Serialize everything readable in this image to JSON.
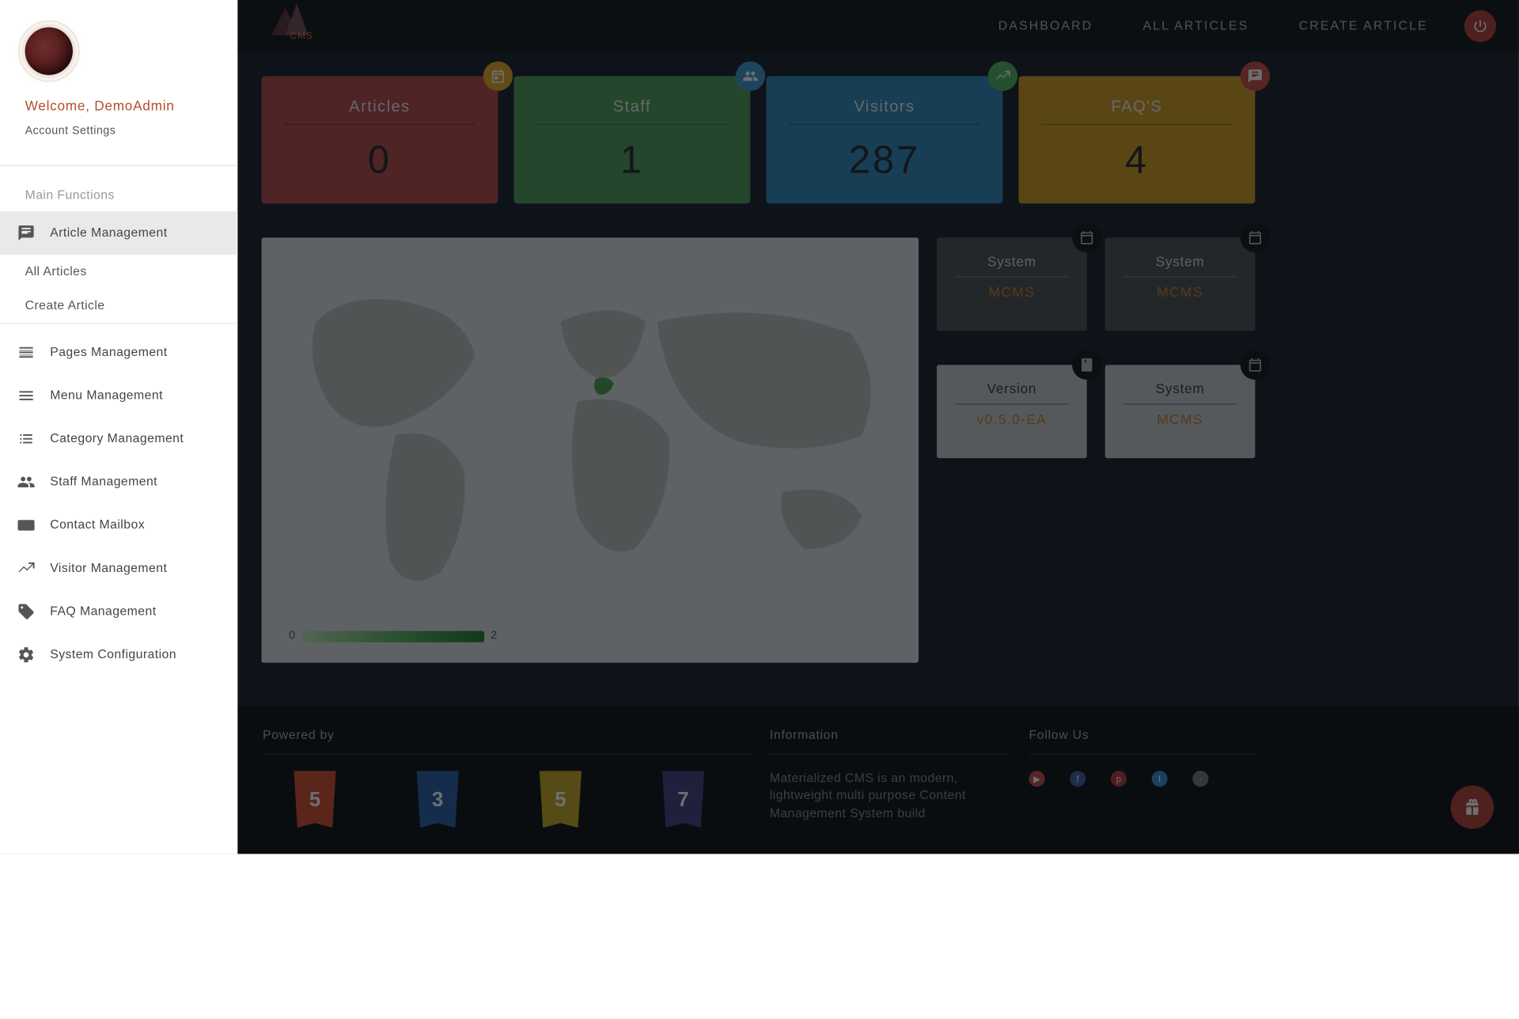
{
  "sidebar": {
    "welcome_text": "Welcome, DemoAdmin",
    "account_settings": "Account Settings",
    "section_label": "Main Functions",
    "items": [
      {
        "label": "Article Management",
        "icon": "article"
      },
      {
        "label": "Pages Management",
        "icon": "pages"
      },
      {
        "label": "Menu Management",
        "icon": "menu"
      },
      {
        "label": "Category Management",
        "icon": "list"
      },
      {
        "label": "Staff Management",
        "icon": "people"
      },
      {
        "label": "Contact Mailbox",
        "icon": "contact"
      },
      {
        "label": "Visitor Management",
        "icon": "trend"
      },
      {
        "label": "FAQ Management",
        "icon": "tag"
      },
      {
        "label": "System Configuration",
        "icon": "settings"
      }
    ],
    "article_sub": [
      {
        "label": "All Articles"
      },
      {
        "label": "Create Article"
      }
    ]
  },
  "topnav": {
    "logo_text": "CMS",
    "links": [
      {
        "label": "DASHBOARD"
      },
      {
        "label": "ALL ARTICLES"
      },
      {
        "label": "CREATE ARTICLE"
      }
    ]
  },
  "stats": [
    {
      "title": "Articles",
      "value": "0",
      "color": "red",
      "badge": "event",
      "badge_color": "orange"
    },
    {
      "title": "Staff",
      "value": "1",
      "color": "green",
      "badge": "people",
      "badge_color": "blue"
    },
    {
      "title": "Visitors",
      "value": "287",
      "color": "blue",
      "badge": "trend",
      "badge_color": "green"
    },
    {
      "title": "FAQ'S",
      "value": "4",
      "color": "orange",
      "badge": "chat",
      "badge_color": "red"
    }
  ],
  "map_legend": {
    "min": "0",
    "max": "2"
  },
  "info_cards": [
    {
      "title": "System",
      "value": "MCMS",
      "dark": true,
      "badge": "event"
    },
    {
      "title": "System",
      "value": "MCMS",
      "dark": true,
      "badge": "event"
    },
    {
      "title": "Version",
      "value": "v0.5.0-EA",
      "dark": false,
      "badge": "book"
    },
    {
      "title": "System",
      "value": "MCMS",
      "dark": false,
      "badge": "event"
    }
  ],
  "footer": {
    "powered_heading": "Powered by",
    "info_heading": "Information",
    "follow_heading": "Follow Us",
    "info_text": "Materialized CMS is an modern, lightweight multi purpose Content Management System build",
    "tech": [
      "5",
      "3",
      "5",
      "7"
    ]
  }
}
